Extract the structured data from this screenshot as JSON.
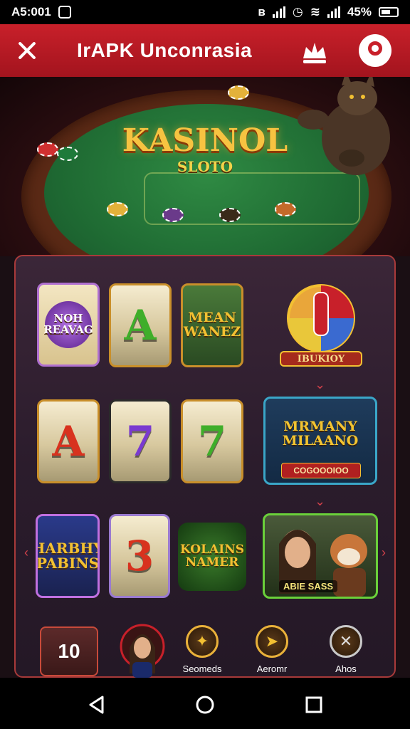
{
  "status_bar": {
    "time": "A5:001",
    "battery_text": "45%"
  },
  "app_bar": {
    "title": "IrAPK Unconrasia"
  },
  "hero": {
    "title": "KASINOL",
    "subtitle": "SLOTO"
  },
  "games": {
    "row1": [
      "NOH REAVAG",
      "A",
      "MEAN WANEZ"
    ],
    "wheel_label": "IBUKIOY",
    "row2": [
      "A",
      "7",
      "7"
    ],
    "promo": {
      "title": "MRMANY MILAANO",
      "button": "COGOOOIOO"
    },
    "row3": [
      "HARBHY PABINS",
      "3",
      "KOLAINS NAMER"
    ],
    "feature_label": "ABIE SASS"
  },
  "bottom_nav": {
    "level": "10",
    "items": [
      "Seomeds",
      "Aeromr",
      "Ahos"
    ]
  },
  "colors": {
    "app_bar": "#c8202a",
    "panel_border": "#a83a3a",
    "gold": "#f2c032",
    "felt": "#1f6b33"
  }
}
